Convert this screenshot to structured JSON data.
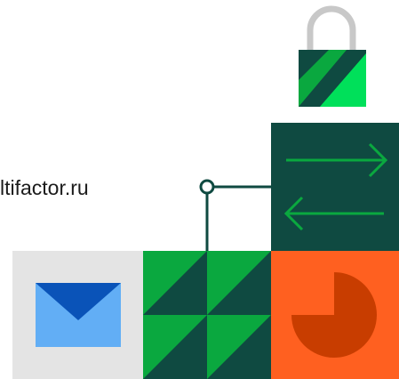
{
  "domain_text": {
    "url_fragment": "ltifactor.ru"
  },
  "icons": {
    "lock": "padlock-icon",
    "arrows": "exchange-arrows-icon",
    "mail": "envelope-icon",
    "pie": "pie-chart-icon",
    "pattern": "triangle-pattern-tile"
  },
  "colors": {
    "dark_green": "#0f4a41",
    "green": "#0aa83f",
    "bright_green": "#00e05a",
    "orange": "#ff6020",
    "dark_orange": "#c83d00",
    "blue": "#0a53b8",
    "light_blue": "#62aef5",
    "light_gray": "#e4e4e4",
    "lock_shackle": "#c8c8c8"
  }
}
